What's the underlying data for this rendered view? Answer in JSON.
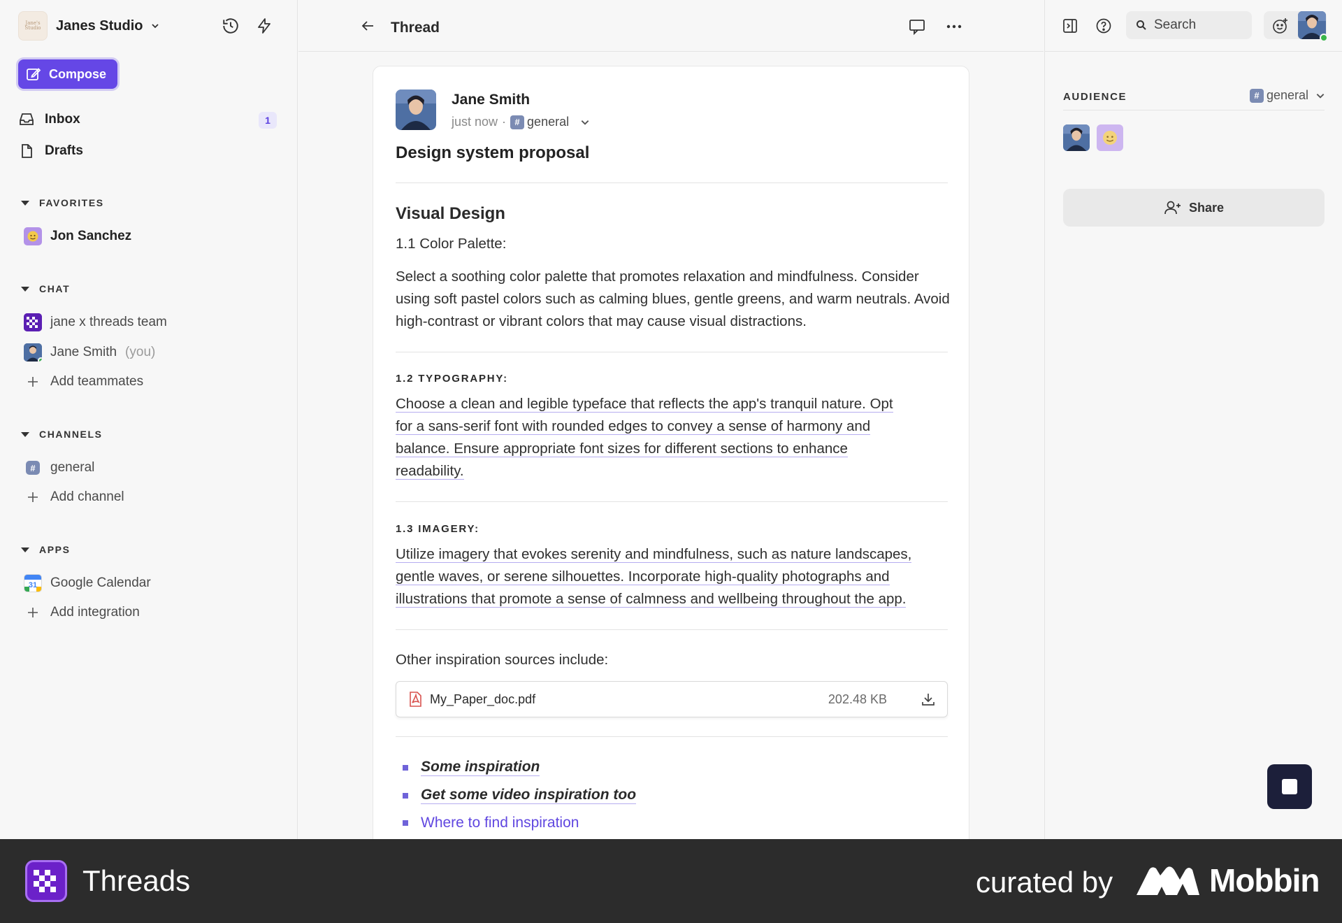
{
  "sidebar": {
    "workspace_logo_text": "Jane's Studio",
    "workspace_name": "Janes Studio",
    "compose_label": "Compose",
    "inbox_label": "Inbox",
    "inbox_count": "1",
    "drafts_label": "Drafts",
    "favorites": {
      "title": "FAVORITES",
      "items": [
        {
          "label": "Jon Sanchez"
        }
      ]
    },
    "chat": {
      "title": "CHAT",
      "items": [
        {
          "label": "jane x threads team"
        },
        {
          "label": "Jane Smith",
          "suffix": "(you)"
        }
      ],
      "add_label": "Add teammates"
    },
    "channels": {
      "title": "CHANNELS",
      "items": [
        {
          "label": "general"
        }
      ],
      "add_label": "Add channel"
    },
    "apps": {
      "title": "APPS",
      "items": [
        {
          "label": "Google Calendar",
          "icon_text": "31"
        }
      ],
      "add_label": "Add integration"
    }
  },
  "main": {
    "title": "Thread",
    "post": {
      "author": "Jane Smith",
      "time": "just now",
      "separator": "·",
      "channel_hash": "#",
      "channel": "general",
      "title": "Design system proposal",
      "section1_heading": "Visual Design",
      "section1_sub": "1.1 Color Palette:",
      "section1_body": "Select a soothing color palette that promotes relaxation and mindfulness. Consider using soft pastel colors such as calming blues, gentle greens, and warm neutrals. Avoid high-contrast or vibrant colors that may cause visual distractions.",
      "section2_heading": "1.2 TYPOGRAPHY:",
      "section2_lines": [
        "Choose a clean and legible typeface that reflects the app's tranquil nature. Opt",
        "for a sans-serif font with rounded edges to convey a sense of harmony and",
        "balance. Ensure appropriate font sizes for different sections to enhance",
        "readability."
      ],
      "section3_heading": "1.3 IMAGERY:",
      "section3_lines": [
        "Utilize imagery that evokes serenity and mindfulness, such as nature landscapes,",
        "gentle waves, or serene silhouettes. Incorporate high-quality photographs and",
        "illustrations that promote a sense of calmness and wellbeing throughout the app."
      ],
      "inspiration_intro": "Other inspiration sources include:",
      "attachment": {
        "name": "My_Paper_doc.pdf",
        "size": "202.48 KB"
      },
      "bullets": [
        "Some inspiration",
        "Get some video inspiration too",
        "Where to find inspiration"
      ]
    }
  },
  "right_panel": {
    "search_placeholder": "Search",
    "audience_label": "AUDIENCE",
    "audience_hash": "#",
    "audience_channel": "general",
    "share_label": "Share"
  },
  "footer": {
    "app_name": "Threads",
    "curated_by": "curated by",
    "brand": "Mobbin"
  },
  "colors": {
    "accent": "#6547e6",
    "link": "#6047e0",
    "underline": "#b6adf0",
    "footer_bg": "#2c2c2c"
  }
}
